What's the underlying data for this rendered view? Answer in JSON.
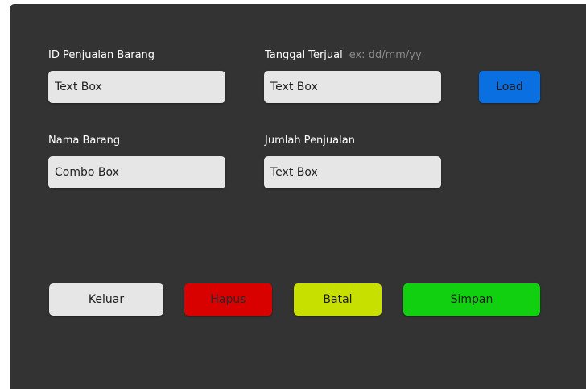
{
  "form": {
    "id_label": "ID Penjualan Barang",
    "id_value": "Text Box",
    "date_label": "Tanggal Terjual",
    "date_hint": "ex: dd/mm/yy",
    "date_value": "Text Box",
    "name_label": "Nama Barang",
    "name_value": "Combo Box",
    "qty_label": "Jumlah Penjualan",
    "qty_value": "Text Box"
  },
  "buttons": {
    "load": "Load",
    "keluar": "Keluar",
    "hapus": "Hapus",
    "batal": "Batal",
    "simpan": "Simpan"
  },
  "colors": {
    "panel": "#333333",
    "field": "#e6e6e6",
    "load": "#0a6fe0",
    "keluar": "#e6e6e6",
    "hapus": "#d90000",
    "batal": "#c8e000",
    "simpan": "#10d010"
  }
}
